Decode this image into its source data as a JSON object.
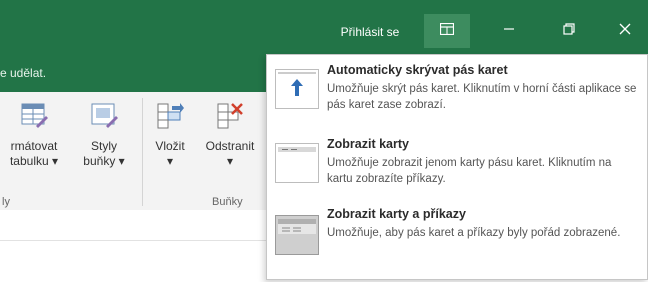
{
  "title_bar": {
    "sign_in_label": "Přihlásit se",
    "icons": [
      "ribbon-display-options-icon",
      "minimize-icon",
      "restore-icon",
      "close-icon"
    ],
    "background_color": "#227447"
  },
  "tell_me": {
    "text": "e udělat."
  },
  "ribbon": {
    "buttons": [
      {
        "line1": "rmátovat",
        "line2": "tabulku ▾",
        "icon": "format-as-table-icon"
      },
      {
        "line1": "Styly",
        "line2": "buňky ▾",
        "icon": "cell-styles-icon"
      },
      {
        "line1": "Vložit",
        "line2": "▾",
        "icon": "insert-cells-icon"
      },
      {
        "line1": "Odstranit",
        "line2": "▾",
        "icon": "delete-cells-icon"
      }
    ],
    "groups": [
      {
        "label": "ly"
      },
      {
        "label": "Buňky"
      }
    ]
  },
  "popup_menu": {
    "items": [
      {
        "title": "Automaticky skrývat pás karet",
        "description": "Umožňuje skrýt pás karet. Kliknutím v horní části aplikace se pás karet zase zobrazí.",
        "icon": "auto-hide-ribbon-icon",
        "selected": false
      },
      {
        "title": "Zobrazit karty",
        "description": "Umožňuje zobrazit jenom karty pásu karet. Kliknutím na kartu zobrazíte příkazy.",
        "icon": "show-tabs-icon",
        "selected": false
      },
      {
        "title": "Zobrazit karty a příkazy",
        "description": "Umožňuje, aby pás karet a příkazy byly pořád zobrazené.",
        "icon": "show-tabs-and-commands-icon",
        "selected": true
      }
    ]
  }
}
